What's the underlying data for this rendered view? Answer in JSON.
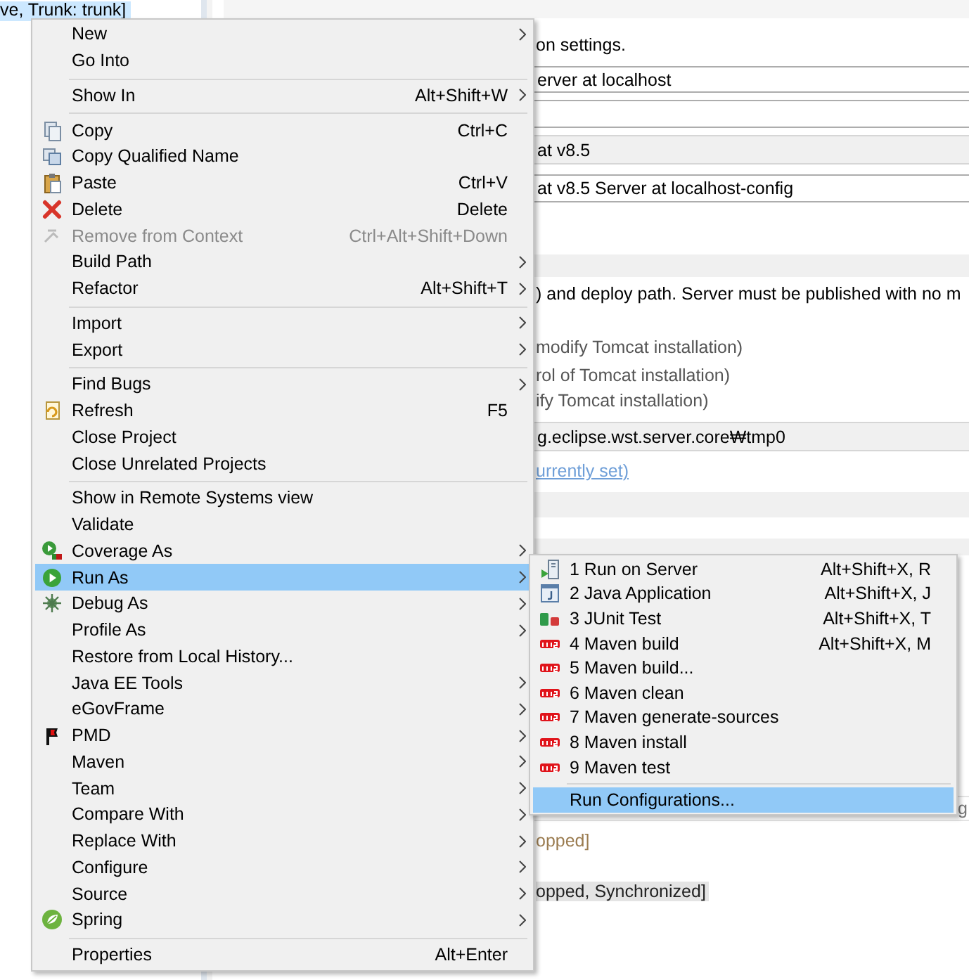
{
  "tree": {
    "selected_item": {
      "label": "ve, Trunk: trunk]",
      "selected": true
    }
  },
  "editor": {
    "rows": [
      {
        "kind": "text",
        "text": "on settings."
      },
      {
        "kind": "field",
        "text": "erver at localhost"
      },
      {
        "kind": "field"
      },
      {
        "kind": "readonly-field",
        "text": "at v8.5"
      },
      {
        "kind": "field",
        "text": "at v8.5 Server at localhost-config"
      },
      {
        "kind": "section-bar"
      },
      {
        "kind": "text",
        "text": ") and deploy path. Server must be published with no m"
      },
      {
        "kind": "dim-text",
        "text": "modify Tomcat installation)"
      },
      {
        "kind": "dim-text",
        "text": "rol of Tomcat installation)"
      },
      {
        "kind": "dim-text",
        "text": "ify Tomcat installation)"
      },
      {
        "kind": "readonly-field",
        "text": "g.eclipse.wst.server.core₩tmp0"
      },
      {
        "kind": "link",
        "text": "urrently set)"
      },
      {
        "kind": "section-bar"
      },
      {
        "kind": "section-bar"
      },
      {
        "kind": "field-end",
        "text": "g"
      },
      {
        "kind": "status",
        "text": "opped]"
      },
      {
        "kind": "status-selected",
        "text": "opped, Synchronized]"
      }
    ]
  },
  "menu": {
    "groups": [
      {
        "items": [
          {
            "kind": "none",
            "label": "New",
            "submenu": true,
            "selected": false,
            "disabled": false
          },
          {
            "kind": "none",
            "label": "Go Into",
            "submenu": false,
            "selected": false,
            "disabled": false
          }
        ]
      },
      {
        "items": [
          {
            "kind": "none",
            "label": "Show In",
            "shortcut": "Alt+Shift+W",
            "submenu": true,
            "selected": false,
            "disabled": false
          }
        ]
      },
      {
        "items": [
          {
            "kind": "copy",
            "label": "Copy",
            "shortcut": "Ctrl+C",
            "submenu": false,
            "selected": false,
            "disabled": false
          },
          {
            "kind": "copy-name",
            "label": "Copy Qualified Name",
            "submenu": false,
            "selected": false,
            "disabled": false
          },
          {
            "kind": "paste",
            "label": "Paste",
            "shortcut": "Ctrl+V",
            "submenu": false,
            "selected": false,
            "disabled": false
          },
          {
            "kind": "delete",
            "label": "Delete",
            "shortcut": "Delete",
            "submenu": false,
            "selected": false,
            "disabled": false
          },
          {
            "kind": "remove",
            "label": "Remove from Context",
            "shortcut": "Ctrl+Alt+Shift+Down",
            "submenu": false,
            "selected": false,
            "disabled": true
          },
          {
            "kind": "none",
            "label": "Build Path",
            "submenu": true,
            "selected": false,
            "disabled": false
          },
          {
            "kind": "none",
            "label": "Refactor",
            "shortcut": "Alt+Shift+T",
            "submenu": true,
            "selected": false,
            "disabled": false
          }
        ]
      },
      {
        "items": [
          {
            "kind": "none",
            "label": "Import",
            "submenu": true,
            "selected": false,
            "disabled": false
          },
          {
            "kind": "none",
            "label": "Export",
            "submenu": true,
            "selected": false,
            "disabled": false
          }
        ]
      },
      {
        "items": [
          {
            "kind": "none",
            "label": "Find Bugs",
            "submenu": true,
            "selected": false,
            "disabled": false
          },
          {
            "kind": "refresh",
            "label": "Refresh",
            "shortcut": "F5",
            "submenu": false,
            "selected": false,
            "disabled": false
          },
          {
            "kind": "none",
            "label": "Close Project",
            "submenu": false,
            "selected": false,
            "disabled": false
          },
          {
            "kind": "none",
            "label": "Close Unrelated Projects",
            "submenu": false,
            "selected": false,
            "disabled": false
          }
        ]
      },
      {
        "items": [
          {
            "kind": "none",
            "label": "Show in Remote Systems view",
            "submenu": false,
            "selected": false,
            "disabled": false
          },
          {
            "kind": "none",
            "label": "Validate",
            "submenu": false,
            "selected": false,
            "disabled": false
          },
          {
            "kind": "coverage",
            "label": "Coverage As",
            "submenu": true,
            "selected": false,
            "disabled": false
          },
          {
            "kind": "run",
            "label": "Run As",
            "submenu": true,
            "selected": true,
            "disabled": false,
            "children": {
              "groups": [
                {
                  "items": [
                    {
                      "kind": "server",
                      "label": "1 Run on Server",
                      "shortcut": "Alt+Shift+X, R",
                      "submenu": false,
                      "selected": false,
                      "disabled": false
                    },
                    {
                      "kind": "java",
                      "label": "2 Java Application",
                      "shortcut": "Alt+Shift+X, J",
                      "submenu": false,
                      "selected": false,
                      "disabled": false
                    },
                    {
                      "kind": "junit",
                      "label": "3 JUnit Test",
                      "shortcut": "Alt+Shift+X, T",
                      "submenu": false,
                      "selected": false,
                      "disabled": false
                    },
                    {
                      "kind": "maven",
                      "label": "4 Maven build",
                      "shortcut": "Alt+Shift+X, M",
                      "submenu": false,
                      "selected": false,
                      "disabled": false
                    },
                    {
                      "kind": "maven",
                      "label": "5 Maven build...",
                      "submenu": false,
                      "selected": false,
                      "disabled": false
                    },
                    {
                      "kind": "maven",
                      "label": "6 Maven clean",
                      "submenu": false,
                      "selected": false,
                      "disabled": false
                    },
                    {
                      "kind": "maven",
                      "label": "7 Maven generate-sources",
                      "submenu": false,
                      "selected": false,
                      "disabled": false
                    },
                    {
                      "kind": "maven",
                      "label": "8 Maven install",
                      "submenu": false,
                      "selected": false,
                      "disabled": false
                    },
                    {
                      "kind": "maven",
                      "label": "9 Maven test",
                      "submenu": false,
                      "selected": false,
                      "disabled": false
                    }
                  ]
                },
                {
                  "items": [
                    {
                      "kind": "none",
                      "label": "Run Configurations...",
                      "submenu": false,
                      "selected": true,
                      "disabled": false
                    }
                  ]
                }
              ]
            }
          },
          {
            "kind": "debug",
            "label": "Debug As",
            "submenu": true,
            "selected": false,
            "disabled": false
          },
          {
            "kind": "none",
            "label": "Profile As",
            "submenu": true,
            "selected": false,
            "disabled": false
          },
          {
            "kind": "none",
            "label": "Restore from Local History...",
            "submenu": false,
            "selected": false,
            "disabled": false
          },
          {
            "kind": "none",
            "label": "Java EE Tools",
            "submenu": true,
            "selected": false,
            "disabled": false
          },
          {
            "kind": "none",
            "label": "eGovFrame",
            "submenu": true,
            "selected": false,
            "disabled": false
          },
          {
            "kind": "pmd",
            "label": "PMD",
            "submenu": true,
            "selected": false,
            "disabled": false
          },
          {
            "kind": "none",
            "label": "Maven",
            "submenu": true,
            "selected": false,
            "disabled": false
          },
          {
            "kind": "none",
            "label": "Team",
            "submenu": true,
            "selected": false,
            "disabled": false
          },
          {
            "kind": "none",
            "label": "Compare With",
            "submenu": true,
            "selected": false,
            "disabled": false
          },
          {
            "kind": "none",
            "label": "Replace With",
            "submenu": true,
            "selected": false,
            "disabled": false
          },
          {
            "kind": "none",
            "label": "Configure",
            "submenu": true,
            "selected": false,
            "disabled": false
          },
          {
            "kind": "none",
            "label": "Source",
            "submenu": true,
            "selected": false,
            "disabled": false
          },
          {
            "kind": "spring",
            "label": "Spring",
            "submenu": true,
            "selected": false,
            "disabled": false
          }
        ]
      },
      {
        "items": [
          {
            "kind": "none",
            "label": "Properties",
            "shortcut": "Alt+Enter",
            "submenu": false,
            "selected": false,
            "disabled": false
          }
        ]
      }
    ]
  }
}
